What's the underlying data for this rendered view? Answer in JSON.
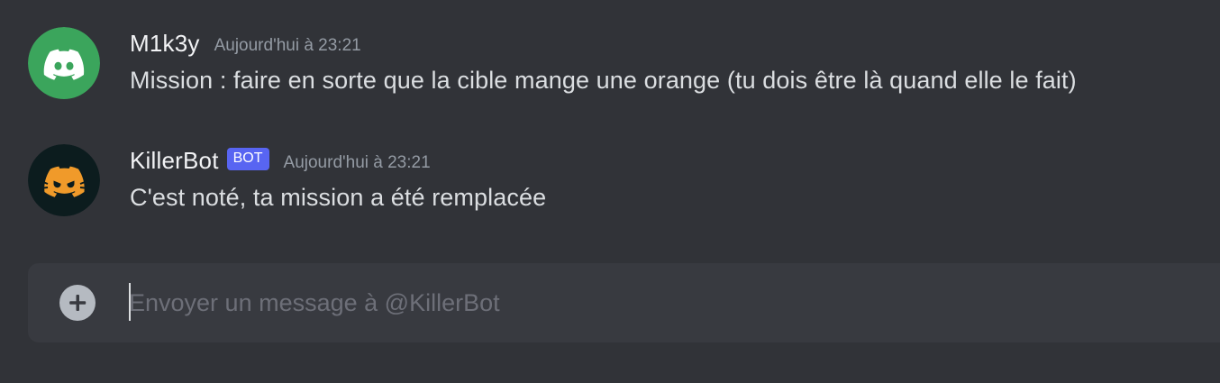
{
  "messages": [
    {
      "username": "M1k3y",
      "timestamp": "Aujourd'hui à 23:21",
      "content": "Mission : faire en sorte que la cible mange une orange (tu dois être là quand elle le fait)",
      "avatar_icon": "discord-logo-icon",
      "avatar_color": "#3ba55c"
    },
    {
      "username": "KillerBot",
      "bot_tag": "BOT",
      "timestamp": "Aujourd'hui à 23:21",
      "content": "C'est noté, ta mission a été remplacée",
      "avatar_icon": "orange-angry-discord-logo-icon",
      "avatar_color": "#0c1c1e"
    }
  ],
  "composer": {
    "placeholder": "Envoyer un message à @KillerBot",
    "add_icon": "plus-circle-icon"
  },
  "colors": {
    "background": "#313338",
    "composer_bg": "#383a40",
    "bot_tag": "#5865f2",
    "timestamp": "#949ba4"
  }
}
